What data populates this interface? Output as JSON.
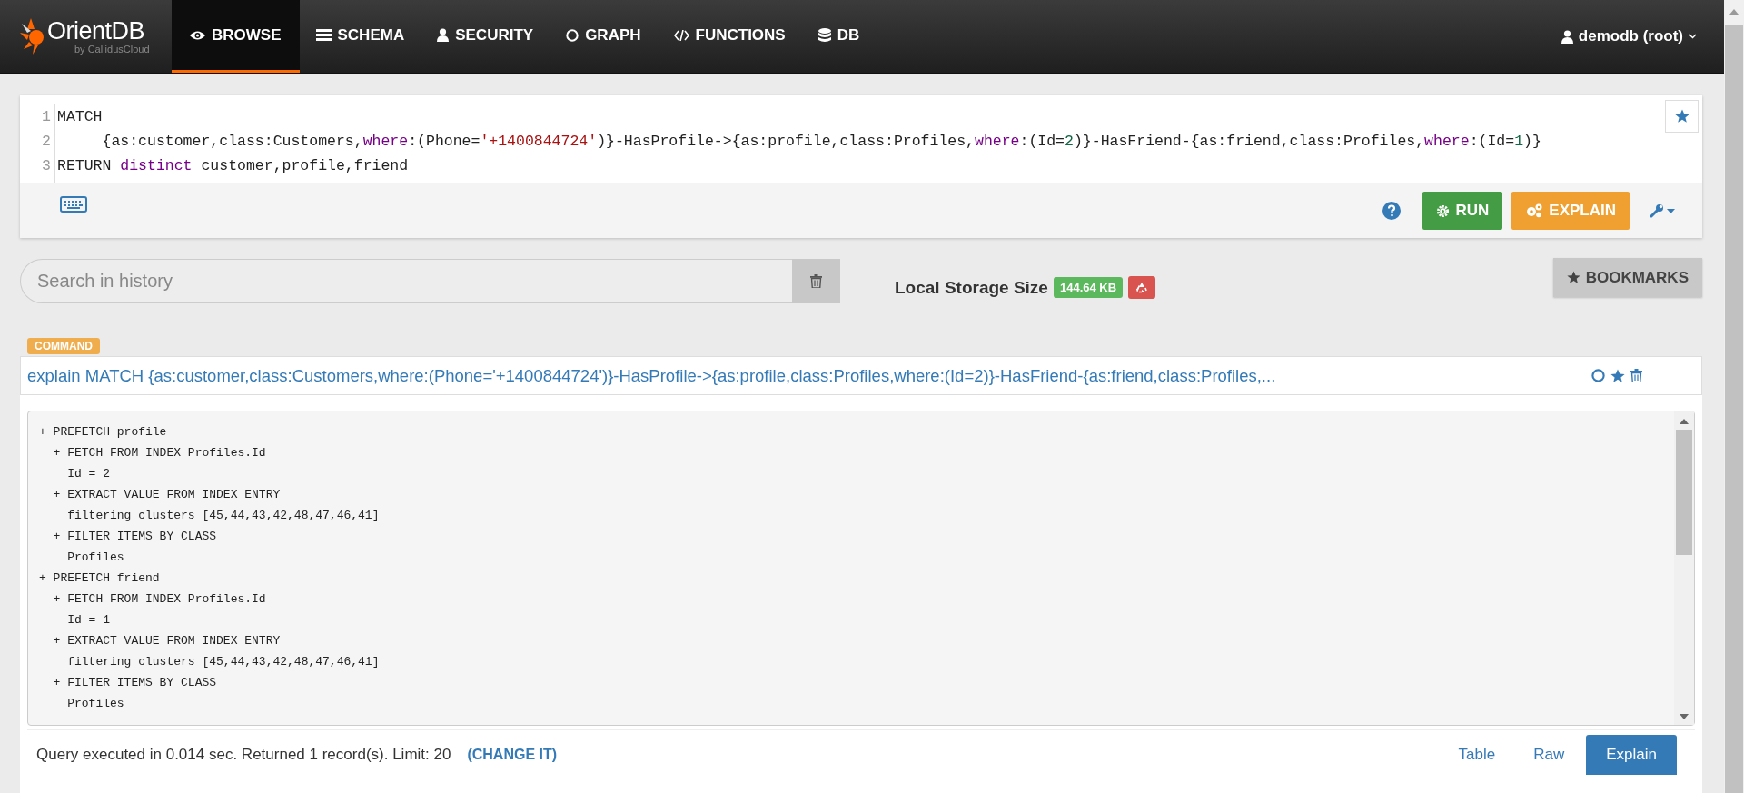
{
  "logo": {
    "name": "OrientDB",
    "tagline": "by CallidusCloud"
  },
  "nav": [
    {
      "label": "BROWSE",
      "kind": "eye",
      "selected": true
    },
    {
      "label": "SCHEMA",
      "kind": "schema",
      "selected": false
    },
    {
      "label": "SECURITY",
      "kind": "user",
      "selected": false
    },
    {
      "label": "GRAPH",
      "kind": "graph",
      "selected": false
    },
    {
      "label": "FUNCTIONS",
      "kind": "code",
      "selected": false
    },
    {
      "label": "DB",
      "kind": "db",
      "selected": false
    }
  ],
  "user_menu": {
    "label": "demodb (root)"
  },
  "editor": {
    "lines": [
      {
        "number": "1",
        "tokens": [
          {
            "text": "MATCH",
            "kind": "plain"
          }
        ]
      },
      {
        "number": "2",
        "tokens": [
          {
            "text": "     {as:customer,class:Customers,",
            "kind": "plain"
          },
          {
            "text": "where",
            "kind": "keyword"
          },
          {
            "text": ":(Phone=",
            "kind": "plain"
          },
          {
            "text": "'+1400844724'",
            "kind": "string"
          },
          {
            "text": ")}-HasProfile->{as:profile,class:Profiles,",
            "kind": "plain"
          },
          {
            "text": "where",
            "kind": "keyword"
          },
          {
            "text": ":(Id=",
            "kind": "plain"
          },
          {
            "text": "2",
            "kind": "number"
          },
          {
            "text": ")}-HasFriend-{as:friend,class:Profiles,",
            "kind": "plain"
          },
          {
            "text": "where",
            "kind": "keyword"
          },
          {
            "text": ":(Id=",
            "kind": "plain"
          },
          {
            "text": "1",
            "kind": "number"
          },
          {
            "text": ")}",
            "kind": "plain"
          }
        ]
      },
      {
        "number": "3",
        "tokens": [
          {
            "text": "RETURN ",
            "kind": "plain"
          },
          {
            "text": "distinct",
            "kind": "keyword"
          },
          {
            "text": " customer,profile,friend",
            "kind": "plain"
          }
        ]
      }
    ],
    "run_button": "RUN",
    "explain_button": "EXPLAIN"
  },
  "history": {
    "search": {
      "placeholder": "Search in history"
    },
    "storage_label": "Local Storage Size",
    "storage_size": "144.64 KB",
    "bookmarks_button": "BOOKMARKS"
  },
  "command": {
    "badge": "COMMAND",
    "query": "explain MATCH {as:customer,class:Customers,where:(Phone='+1400844724')}-HasProfile->{as:profile,class:Profiles,where:(Id=2)}-HasFriend-{as:friend,class:Profiles,...",
    "output": [
      "+ PREFETCH profile",
      "  + FETCH FROM INDEX Profiles.Id",
      "    Id = 2",
      "  + EXTRACT VALUE FROM INDEX ENTRY",
      "    filtering clusters [45,44,43,42,48,47,46,41]",
      "  + FILTER ITEMS BY CLASS",
      "    Profiles",
      "+ PREFETCH friend",
      "  + FETCH FROM INDEX Profiles.Id",
      "    Id = 1",
      "  + EXTRACT VALUE FROM INDEX ENTRY",
      "    filtering clusters [45,44,43,42,48,47,46,41]",
      "  + FILTER ITEMS BY CLASS",
      "    Profiles"
    ],
    "status": "Query executed in 0.014 sec. Returned 1 record(s). Limit: 20",
    "change_link": "(CHANGE IT)",
    "views": [
      {
        "label": "Table",
        "selected": false
      },
      {
        "label": "Raw",
        "selected": false
      },
      {
        "label": "Explain",
        "selected": true
      }
    ]
  }
}
